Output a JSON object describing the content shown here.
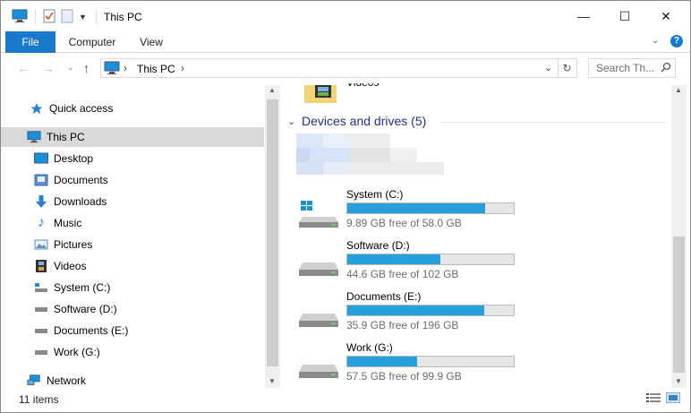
{
  "window": {
    "title": "This PC",
    "minimize_glyph": "—",
    "maximize_glyph": "☐",
    "close_glyph": "✕"
  },
  "ribbon": {
    "tabs": [
      {
        "label": "File"
      },
      {
        "label": "Computer"
      },
      {
        "label": "View"
      }
    ]
  },
  "address": {
    "crumb": "This PC",
    "separator": "›",
    "search_placeholder": "Search Th..."
  },
  "nav": {
    "items": [
      {
        "label": "Quick access",
        "icon": "star-icon"
      },
      {
        "label": "This PC",
        "icon": "computer-icon",
        "selected": true
      },
      {
        "label": "Desktop",
        "icon": "desktop-icon"
      },
      {
        "label": "Documents",
        "icon": "documents-icon"
      },
      {
        "label": "Downloads",
        "icon": "download-arrow-icon"
      },
      {
        "label": "Music",
        "icon": "music-note-icon"
      },
      {
        "label": "Pictures",
        "icon": "pictures-icon"
      },
      {
        "label": "Videos",
        "icon": "film-icon"
      },
      {
        "label": "System (C:)",
        "icon": "system-drive-icon"
      },
      {
        "label": "Software (D:)",
        "icon": "drive-icon"
      },
      {
        "label": "Documents (E:)",
        "icon": "drive-icon"
      },
      {
        "label": "Work (G:)",
        "icon": "drive-icon"
      },
      {
        "label": "Network",
        "icon": "network-icon"
      }
    ]
  },
  "content": {
    "partial_folder": "Videos",
    "section_title": "Devices and drives (5)",
    "drives": [
      {
        "name": "System (C:)",
        "free_text": "9.89 GB free of 58.0 GB",
        "used_fraction": 0.83,
        "icon": "system-drive-icon"
      },
      {
        "name": "Software (D:)",
        "free_text": "44.6 GB free of 102 GB",
        "used_fraction": 0.56,
        "icon": "drive-icon"
      },
      {
        "name": "Documents (E:)",
        "free_text": "35.9 GB free of 196 GB",
        "used_fraction": 0.82,
        "icon": "drive-icon"
      },
      {
        "name": "Work (G:)",
        "free_text": "57.5 GB free of 99.9 GB",
        "used_fraction": 0.42,
        "icon": "drive-icon"
      }
    ]
  },
  "status": {
    "items_count": "11 items"
  },
  "colors": {
    "accent": "#1979ca",
    "bar_fill": "#26a0da",
    "section_title": "#1e3287"
  }
}
